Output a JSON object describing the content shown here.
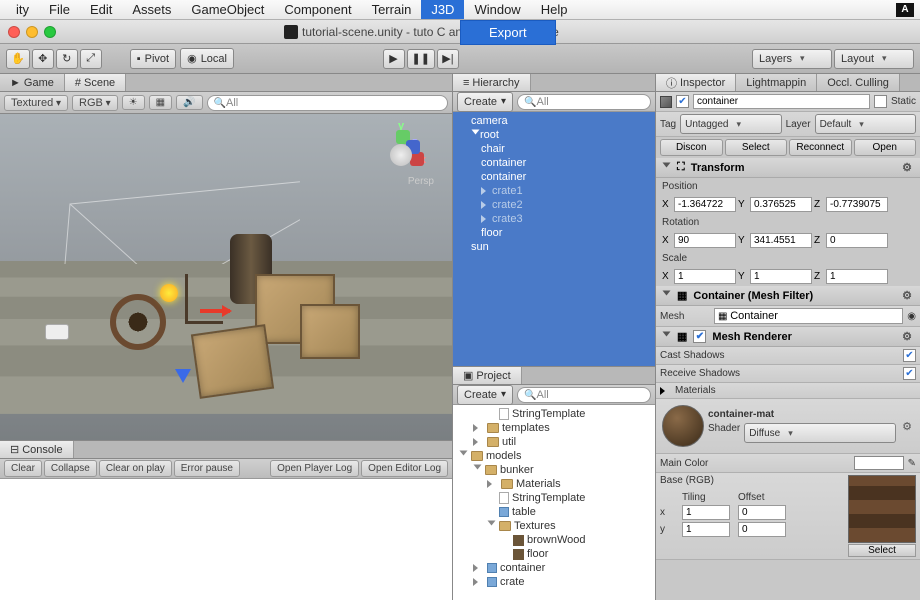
{
  "menubar": {
    "items": [
      "ity",
      "File",
      "Edit",
      "Assets",
      "GameObject",
      "Component",
      "Terrain",
      "J3D",
      "Window",
      "Help"
    ],
    "active_index": 7
  },
  "export_menu": {
    "label": "Export"
  },
  "titlebar": {
    "text": "tutorial-scene.unity - tuto          C and Mac Standalone"
  },
  "toolbar": {
    "pivot": "Pivot",
    "local": "Local",
    "layers": "Layers",
    "layout": "Layout"
  },
  "scene_tabs": {
    "game": "Game",
    "scene": "Scene"
  },
  "scene_tb": {
    "textured": "Textured",
    "rgb": "RGB",
    "search": "All",
    "persp": "Persp",
    "axes": {
      "x": "x",
      "y": "y",
      "z": "z"
    }
  },
  "console": {
    "tab": "Console",
    "clear": "Clear",
    "collapse": "Collapse",
    "cop": "Clear on play",
    "ep": "Error pause",
    "opl": "Open Player Log",
    "oel": "Open Editor Log"
  },
  "hierarchy": {
    "title": "Hierarchy",
    "create": "Create",
    "search": "All",
    "items": [
      {
        "n": "camera",
        "d": 0
      },
      {
        "n": "root",
        "d": 0,
        "open": true
      },
      {
        "n": "chair",
        "d": 1
      },
      {
        "n": "container",
        "d": 1
      },
      {
        "n": "container",
        "d": 1
      },
      {
        "n": "crate1",
        "d": 1,
        "faded": true,
        "arrow": true
      },
      {
        "n": "crate2",
        "d": 1,
        "faded": true,
        "arrow": true
      },
      {
        "n": "crate3",
        "d": 1,
        "faded": true,
        "arrow": true
      },
      {
        "n": "floor",
        "d": 1
      },
      {
        "n": "sun",
        "d": 0
      }
    ]
  },
  "project": {
    "title": "Project",
    "create": "Create",
    "search": "All",
    "items": [
      {
        "n": "StringTemplate",
        "d": 2,
        "t": "pg"
      },
      {
        "n": "templates",
        "d": 1,
        "t": "fold",
        "arrow": true
      },
      {
        "n": "util",
        "d": 1,
        "t": "fold",
        "arrow": true
      },
      {
        "n": "models",
        "d": 0,
        "t": "fold",
        "open": true
      },
      {
        "n": "bunker",
        "d": 1,
        "t": "fold",
        "open": true
      },
      {
        "n": "Materials",
        "d": 2,
        "t": "fold",
        "arrow": true
      },
      {
        "n": "StringTemplate",
        "d": 2,
        "t": "pg"
      },
      {
        "n": "table",
        "d": 2,
        "t": "prefab"
      },
      {
        "n": "Textures",
        "d": 2,
        "t": "fold",
        "open": true
      },
      {
        "n": "brownWood",
        "d": 3,
        "t": "tex"
      },
      {
        "n": "floor",
        "d": 3,
        "t": "tex"
      },
      {
        "n": "container",
        "d": 1,
        "t": "prefab",
        "arrow": true
      },
      {
        "n": "crate",
        "d": 1,
        "t": "prefab",
        "arrow": true
      }
    ]
  },
  "inspector": {
    "tabs": [
      "Inspector",
      "Lightmappin",
      "Occl. Culling"
    ],
    "name": "container",
    "static": "Static",
    "tag_l": "Tag",
    "tag": "Untagged",
    "layer_l": "Layer",
    "layer": "Default",
    "discon": "Discon",
    "select": "Select",
    "reconnect": "Reconnect",
    "open": "Open",
    "transform": "Transform",
    "pos_l": "Position",
    "rot_l": "Rotation",
    "scale_l": "Scale",
    "pos": {
      "x": "-1.364722",
      "y": "0.376525",
      "z": "-0.7739075"
    },
    "rot": {
      "x": "90",
      "y": "341.4551",
      "z": "0"
    },
    "scale": {
      "x": "1",
      "y": "1",
      "z": "1"
    },
    "meshfilter": "Container (Mesh Filter)",
    "mesh_l": "Mesh",
    "mesh_v": "Container",
    "meshrend": "Mesh Renderer",
    "cast": "Cast Shadows",
    "recv": "Receive Shadows",
    "mats": "Materials",
    "mat_name": "container-mat",
    "shader_l": "Shader",
    "shader": "Diffuse",
    "maincol": "Main Color",
    "base": "Base (RGB)",
    "tiling": "Tiling",
    "offset": "Offset",
    "tx": "1",
    "ty": "1",
    "ox": "0",
    "oy": "0",
    "select_btn": "Select",
    "X": "X",
    "Y": "Y",
    "Z": "Z",
    "xl": "x",
    "yl": "y"
  }
}
